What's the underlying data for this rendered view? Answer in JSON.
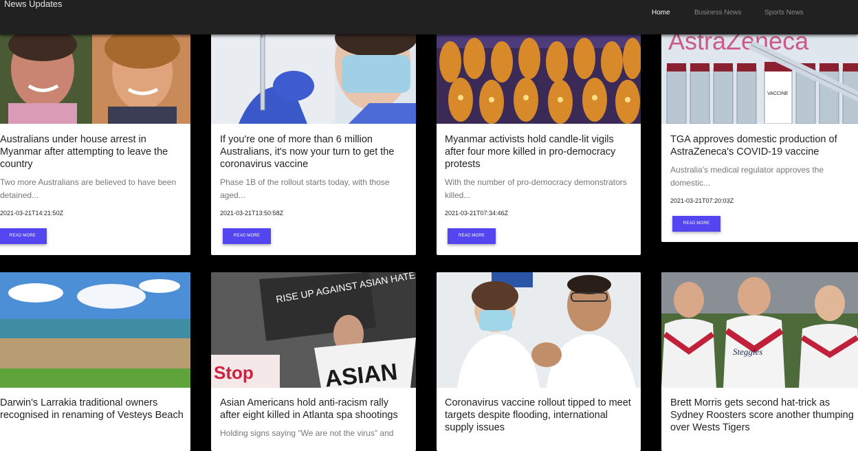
{
  "navbar": {
    "brand": "News Updates",
    "links": [
      {
        "label": "Home",
        "active": true
      },
      {
        "label": "Business News",
        "active": false
      },
      {
        "label": "Sports News",
        "active": false
      }
    ]
  },
  "articles": [
    {
      "title": "Australians under house arrest in Myanmar after attempting to leave the country",
      "description": "Two more Australians are believed to have been detained...",
      "date": "2021-03-21T14:21:50Z",
      "button": "READ MORE",
      "image": "two-people-smiling-portrait"
    },
    {
      "title": "If you're one of more than 6 million Australians, it's now your turn to get the coronavirus vaccine",
      "description": "Phase 1B of the rollout starts today, with those aged...",
      "date": "2021-03-21T13:50:58Z",
      "button": "READ MORE",
      "image": "health-worker-with-syringe"
    },
    {
      "title": "Myanmar activists hold candle-lit vigils after four more killed in pro-democracy protests",
      "description": "With the number of pro-democracy demonstrators killed...",
      "date": "2021-03-21T07:34:46Z",
      "button": "READ MORE",
      "image": "monks-candle-vigil"
    },
    {
      "title": "TGA approves domestic production of AstraZeneca's COVID-19 vaccine",
      "description": "Australia's medical regulator approves the domestic...",
      "date": "2021-03-21T07:20:03Z",
      "button": "READ MORE",
      "image": "astrazeneca-vaccine-vials"
    },
    {
      "title": "Darwin's Larrakia traditional owners recognised in renaming of Vesteys Beach",
      "image": "beach-landscape"
    },
    {
      "title": "Asian Americans hold anti-racism rally after eight killed in Atlanta spa shootings",
      "description": "Holding signs saying \"We are not the virus\" and",
      "image": "protest-signs",
      "signs": [
        "RISE UP AGAINST ASIAN HATE",
        "ASIAN",
        "Stop"
      ]
    },
    {
      "title": "Coronavirus vaccine rollout tipped to meet targets despite flooding, international supply issues",
      "image": "nurse-vaccinating-man"
    },
    {
      "title": "Brett Morris gets second hat-trick as Sydney Roosters score another thumping over Wests Tigers",
      "image": "rugby-players-celebrating",
      "jersey_text": "Steggles"
    }
  ],
  "image_labels": {
    "astrazeneca": "AstraZeneca",
    "vaccine": "VACCINE"
  }
}
